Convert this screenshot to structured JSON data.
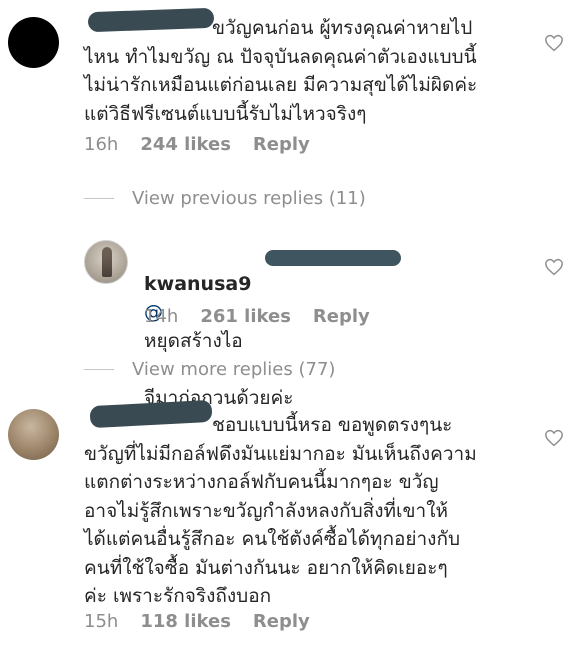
{
  "comments": [
    {
      "text": "ขวัญคนก่อน ผู้ทรงคุณค่าหายไป\nไหน ทำไมขวัญ ณ ปัจจุบันลดคุณค่าตัวเองแบบนี้\nไม่น่ารักเหมือนแต่ก่อนเลย มีความสุขได้ไม่ผิดค่ะ\nแต่วิธีฟรีเซนต์แบบนี้รับไม่ไหวจริงๆ",
      "time": "16h",
      "likes": "244 likes",
      "reply": "Reply"
    },
    {
      "text": "ชอบแบบนี้หรอ ขอพูดตรงๆนะ\nขวัญที่ไม่มีกอล์ฟดึงมันแย่มากอะ มันเห็นถึงความ\nแตกต่างระหว่างกอล์ฟกับคนนี้มากๆอะ ขวัญ\nอาจไม่รู้สึกเพราะขวัญกำลังหลงกับสิ่งที่เขาให้\nได้แต่คนอื่นรู้สึกอะ คนใช้ตังค์ซื้อได้ทุกอย่างกับ\nคนที่ใช้ใจซื้อ มันต่างกันนะ อยากให้คิดเยอะๆ\nค่ะ เพราะรักจริงถึงบอก",
      "time": "15h",
      "likes": "118 likes",
      "reply": "Reply"
    }
  ],
  "view_previous": "View previous replies (11)",
  "reply_comment": {
    "username": "kwanusa9",
    "mention": "@",
    "text_line1": "หยุดสร้างไอ",
    "text_line2": "จีมาก่อกวนด้วยค่ะ",
    "time": "14h",
    "likes": "261 likes",
    "reply": "Reply"
  },
  "view_more": "View more replies (77)",
  "icons": {
    "like": "heart-outline-icon"
  },
  "colors": {
    "text": "#262626",
    "muted": "#8e8e8e",
    "mention": "#003569"
  }
}
